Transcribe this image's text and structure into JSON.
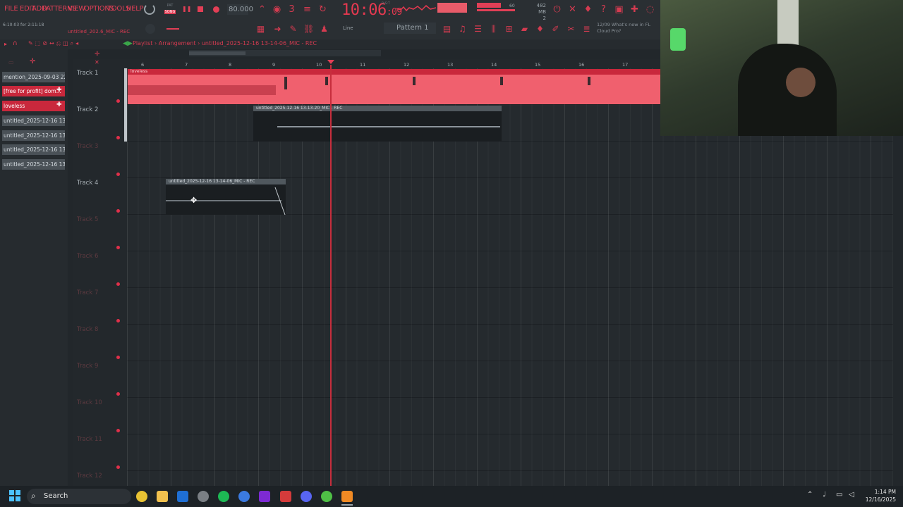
{
  "menu": [
    "FILE",
    "EDIT",
    "ADD",
    "PATTERNS",
    "VIEW",
    "OPTIONS",
    "TOOLS",
    "HELP"
  ],
  "transport": {
    "song_label": "SONG",
    "pat_label": "PAT",
    "tempo": "80.000"
  },
  "clock": {
    "main": "10:06",
    "sub": ":09",
    "bst": "B:S:T"
  },
  "cpu": {
    "mem": "482 MB",
    "voices": "2",
    "poly": "60"
  },
  "hint": {
    "time": "6:10:03 for 2:11:18",
    "file": "untitled_202.6_MIC - REC"
  },
  "snap": {
    "label": "Line"
  },
  "pattern": {
    "label": "Pattern 1"
  },
  "news": {
    "date": "12/09",
    "text": "What's new in FL Cloud Pro?"
  },
  "playlist": {
    "breadcrumb": [
      "Playlist",
      "Arrangement",
      "untitled_2025-12-16 13-14-06_MIC - REC"
    ],
    "ruler": [
      "6",
      "7",
      "8",
      "9",
      "10",
      "11",
      "12",
      "13",
      "14",
      "15",
      "16",
      "17"
    ]
  },
  "browser": {
    "items": [
      {
        "label": "mention_2025-09-03 22...",
        "style": "grey"
      },
      {
        "label": "[free for profit] dom...",
        "style": "red"
      },
      {
        "label": "loveless",
        "style": "red"
      },
      {
        "label": "untitled_2025-12-16 13-...",
        "style": "grey"
      },
      {
        "label": "untitled_2025-12-16 13-...",
        "style": "grey"
      },
      {
        "label": "untitled_2025-12-16 13-...",
        "style": "grey"
      },
      {
        "label": "untitled_2025-12-16 13-...",
        "style": "grey"
      }
    ]
  },
  "tracks": [
    "Track 1",
    "Track 2",
    "Track 3",
    "Track 4",
    "Track 5",
    "Track 6",
    "Track 7",
    "Track 8",
    "Track 9",
    "Track 10",
    "Track 11",
    "Track 12"
  ],
  "clips": {
    "track1": "loveless",
    "track2": "untitled_2025-12-16 13-13-20_MIC - REC",
    "track4": "untitled_2025-12-16 13-14-06_MIC - REC"
  },
  "taskbar": {
    "search": "Search",
    "time": "1:14 PM",
    "date": "12/16/2025"
  },
  "colors": {
    "accent": "#e53950",
    "clip_pink": "#f2606e",
    "bg": "#252a2e"
  }
}
